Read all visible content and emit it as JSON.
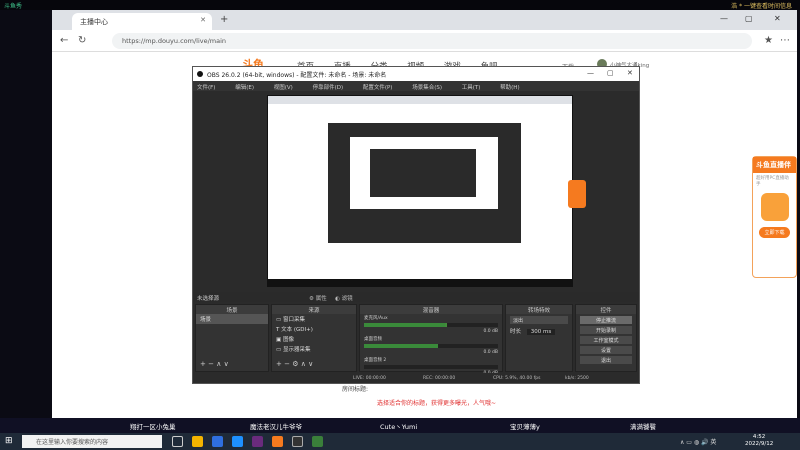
{
  "topbar": {
    "logo": "斗鱼秀",
    "right_text": "浩 * 一键查看时间信息"
  },
  "browser": {
    "tab_title": "主播中心",
    "url": "https://mp.douyu.com/live/main"
  },
  "douyu": {
    "logo": "斗鱼",
    "nav": [
      "首页",
      "直播",
      "分类",
      "视频",
      "游戏",
      "鱼吧"
    ],
    "download": "下载",
    "username": "小神气大通king"
  },
  "ad": {
    "title": "斗鱼直播伴",
    "subtitle": "超好用PC直播助手",
    "button": "立即下载"
  },
  "page_lower": {
    "label": "房间标题:",
    "red_text": "选择适合你的标题，获得更多曝光，人气哦~"
  },
  "obs": {
    "title": "OBS 26.0.2 (64-bit, windows) - 配置文件: 未命名 - 场景: 未命名",
    "menu": [
      "文件(F)",
      "编辑(E)",
      "视图(V)",
      "停靠部件(D)",
      "配置文件(P)",
      "场景集合(S)",
      "工具(T)",
      "帮助(H)"
    ],
    "no_source": "未选择源",
    "props": "属性",
    "filters": "滤镜",
    "docks": {
      "scenes": {
        "title": "场景",
        "items": [
          "场景"
        ]
      },
      "sources": {
        "title": "来源",
        "items": [
          "窗口采集",
          "文本 (GDI+)",
          "图像",
          "显示器采集"
        ]
      },
      "mixer": {
        "title": "混音器",
        "channels": [
          {
            "name": "麦克风/Aux",
            "db": "0.0 dB",
            "level": 0.62
          },
          {
            "name": "桌面音频",
            "db": "0.0 dB",
            "level": 0.55
          },
          {
            "name": "桌面音频 2",
            "db": "0.0 dB",
            "level": 0.0
          }
        ]
      },
      "transitions": {
        "title": "转场特效",
        "type": "淡出",
        "duration_label": "时长",
        "duration": "300 ms"
      },
      "controls": {
        "title": "控件",
        "buttons": [
          "停止推流",
          "开始录制",
          "工作室模式",
          "设置",
          "退出"
        ]
      }
    },
    "status": {
      "live": "LIVE: 00:00:00",
      "rec": "REC: 00:00:00",
      "cpu": "CPU: 5.9%, 40.00 fps",
      "dropped": "丢帧 0 (0.0%)",
      "kbps": "kb/s: 2500"
    }
  },
  "strip": [
    "翔打一区小兔巢",
    "魔法老汉儿牛爷爷",
    "Cute丶Yumi",
    "宝贝薄薄y",
    "满满饕餮"
  ],
  "taskbar": {
    "search_placeholder": "在这里输入你要搜索的内容",
    "time": "4:52",
    "date": "2022/9/12"
  },
  "colors": {
    "accent": "#f57a1f",
    "obs_bg": "#2b2b2b",
    "taskbar": "#1f2a38"
  }
}
